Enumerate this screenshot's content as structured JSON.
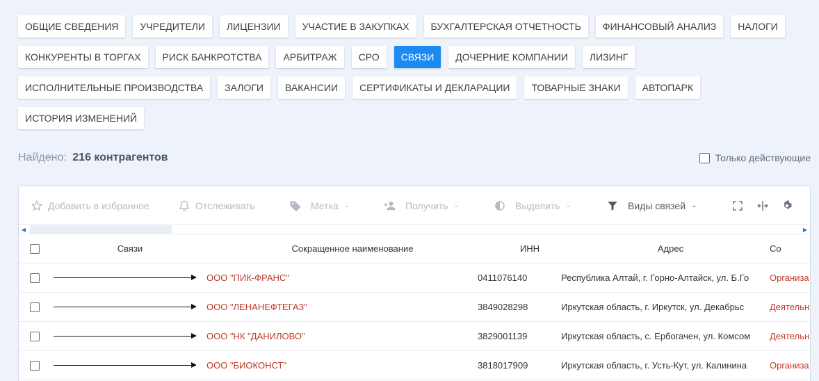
{
  "tabs": [
    [
      "Общие сведения",
      "Учредители",
      "Лицензии",
      "Участие в закупках",
      "Бухгалтерская отчетность",
      "Финансовый анализ",
      "Налоги"
    ],
    [
      "Конкуренты в торгах",
      "Риск банкротства",
      "Арбитраж",
      "СРО",
      "Связи",
      "Дочерние компании",
      "Лизинг"
    ],
    [
      "Исполнительные производства",
      "Залоги",
      "Вакансии",
      "Сертификаты и декларации",
      "Товарные знаки",
      "Автопарк"
    ],
    [
      "История изменений"
    ]
  ],
  "active_tab": "Связи",
  "found": {
    "label": "Найдено:",
    "count": "216 контрагентов"
  },
  "only_active_label": "Только действующие",
  "toolbar": {
    "favorite": "Добавить в избранное",
    "track": "Отслеживать",
    "tag": "Метка",
    "assign": "Получить",
    "highlight": "Выделить",
    "link_types": "Виды связей"
  },
  "table": {
    "headers": {
      "links": "Связи",
      "name": "Сокращенное наименование",
      "inn": "ИНН",
      "address": "Адрес",
      "status": "Со"
    },
    "rows": [
      {
        "name": "ООО \"ПИК-ФРАНС\"",
        "inn": "0411076140",
        "address": "Республика Алтай, г. Горно-Алтайск, ул. Б.Го",
        "status": "Организа"
      },
      {
        "name": "ООО \"ЛЕНАНЕФТЕГАЗ\"",
        "inn": "3849028298",
        "address": "Иркутская область, г. Иркутск, ул. Декабрьс",
        "status": "Деятельн"
      },
      {
        "name": "ООО \"НК \"ДАНИЛОВО\"",
        "inn": "3829001139",
        "address": "Иркутская область, с. Ербогачен, ул. Комсом",
        "status": "Деятельн"
      },
      {
        "name": "ООО \"БИОКОНСТ\"",
        "inn": "3818017909",
        "address": "Иркутская область, г. Усть-Кут, ул. Калинина",
        "status": "Организа"
      }
    ]
  },
  "colors": {
    "accent": "#1a8bf2",
    "link": "#c0392b",
    "background": "#eef3fb"
  },
  "icons": {
    "favorite": "star-icon",
    "track": "bell-icon",
    "tag": "tag-icon",
    "assign": "person-add-icon",
    "highlight": "contrast-icon",
    "link_types": "filter-icon",
    "fullscreen": "fullscreen-icon",
    "width": "column-width-icon",
    "settings": "gear-icon"
  }
}
